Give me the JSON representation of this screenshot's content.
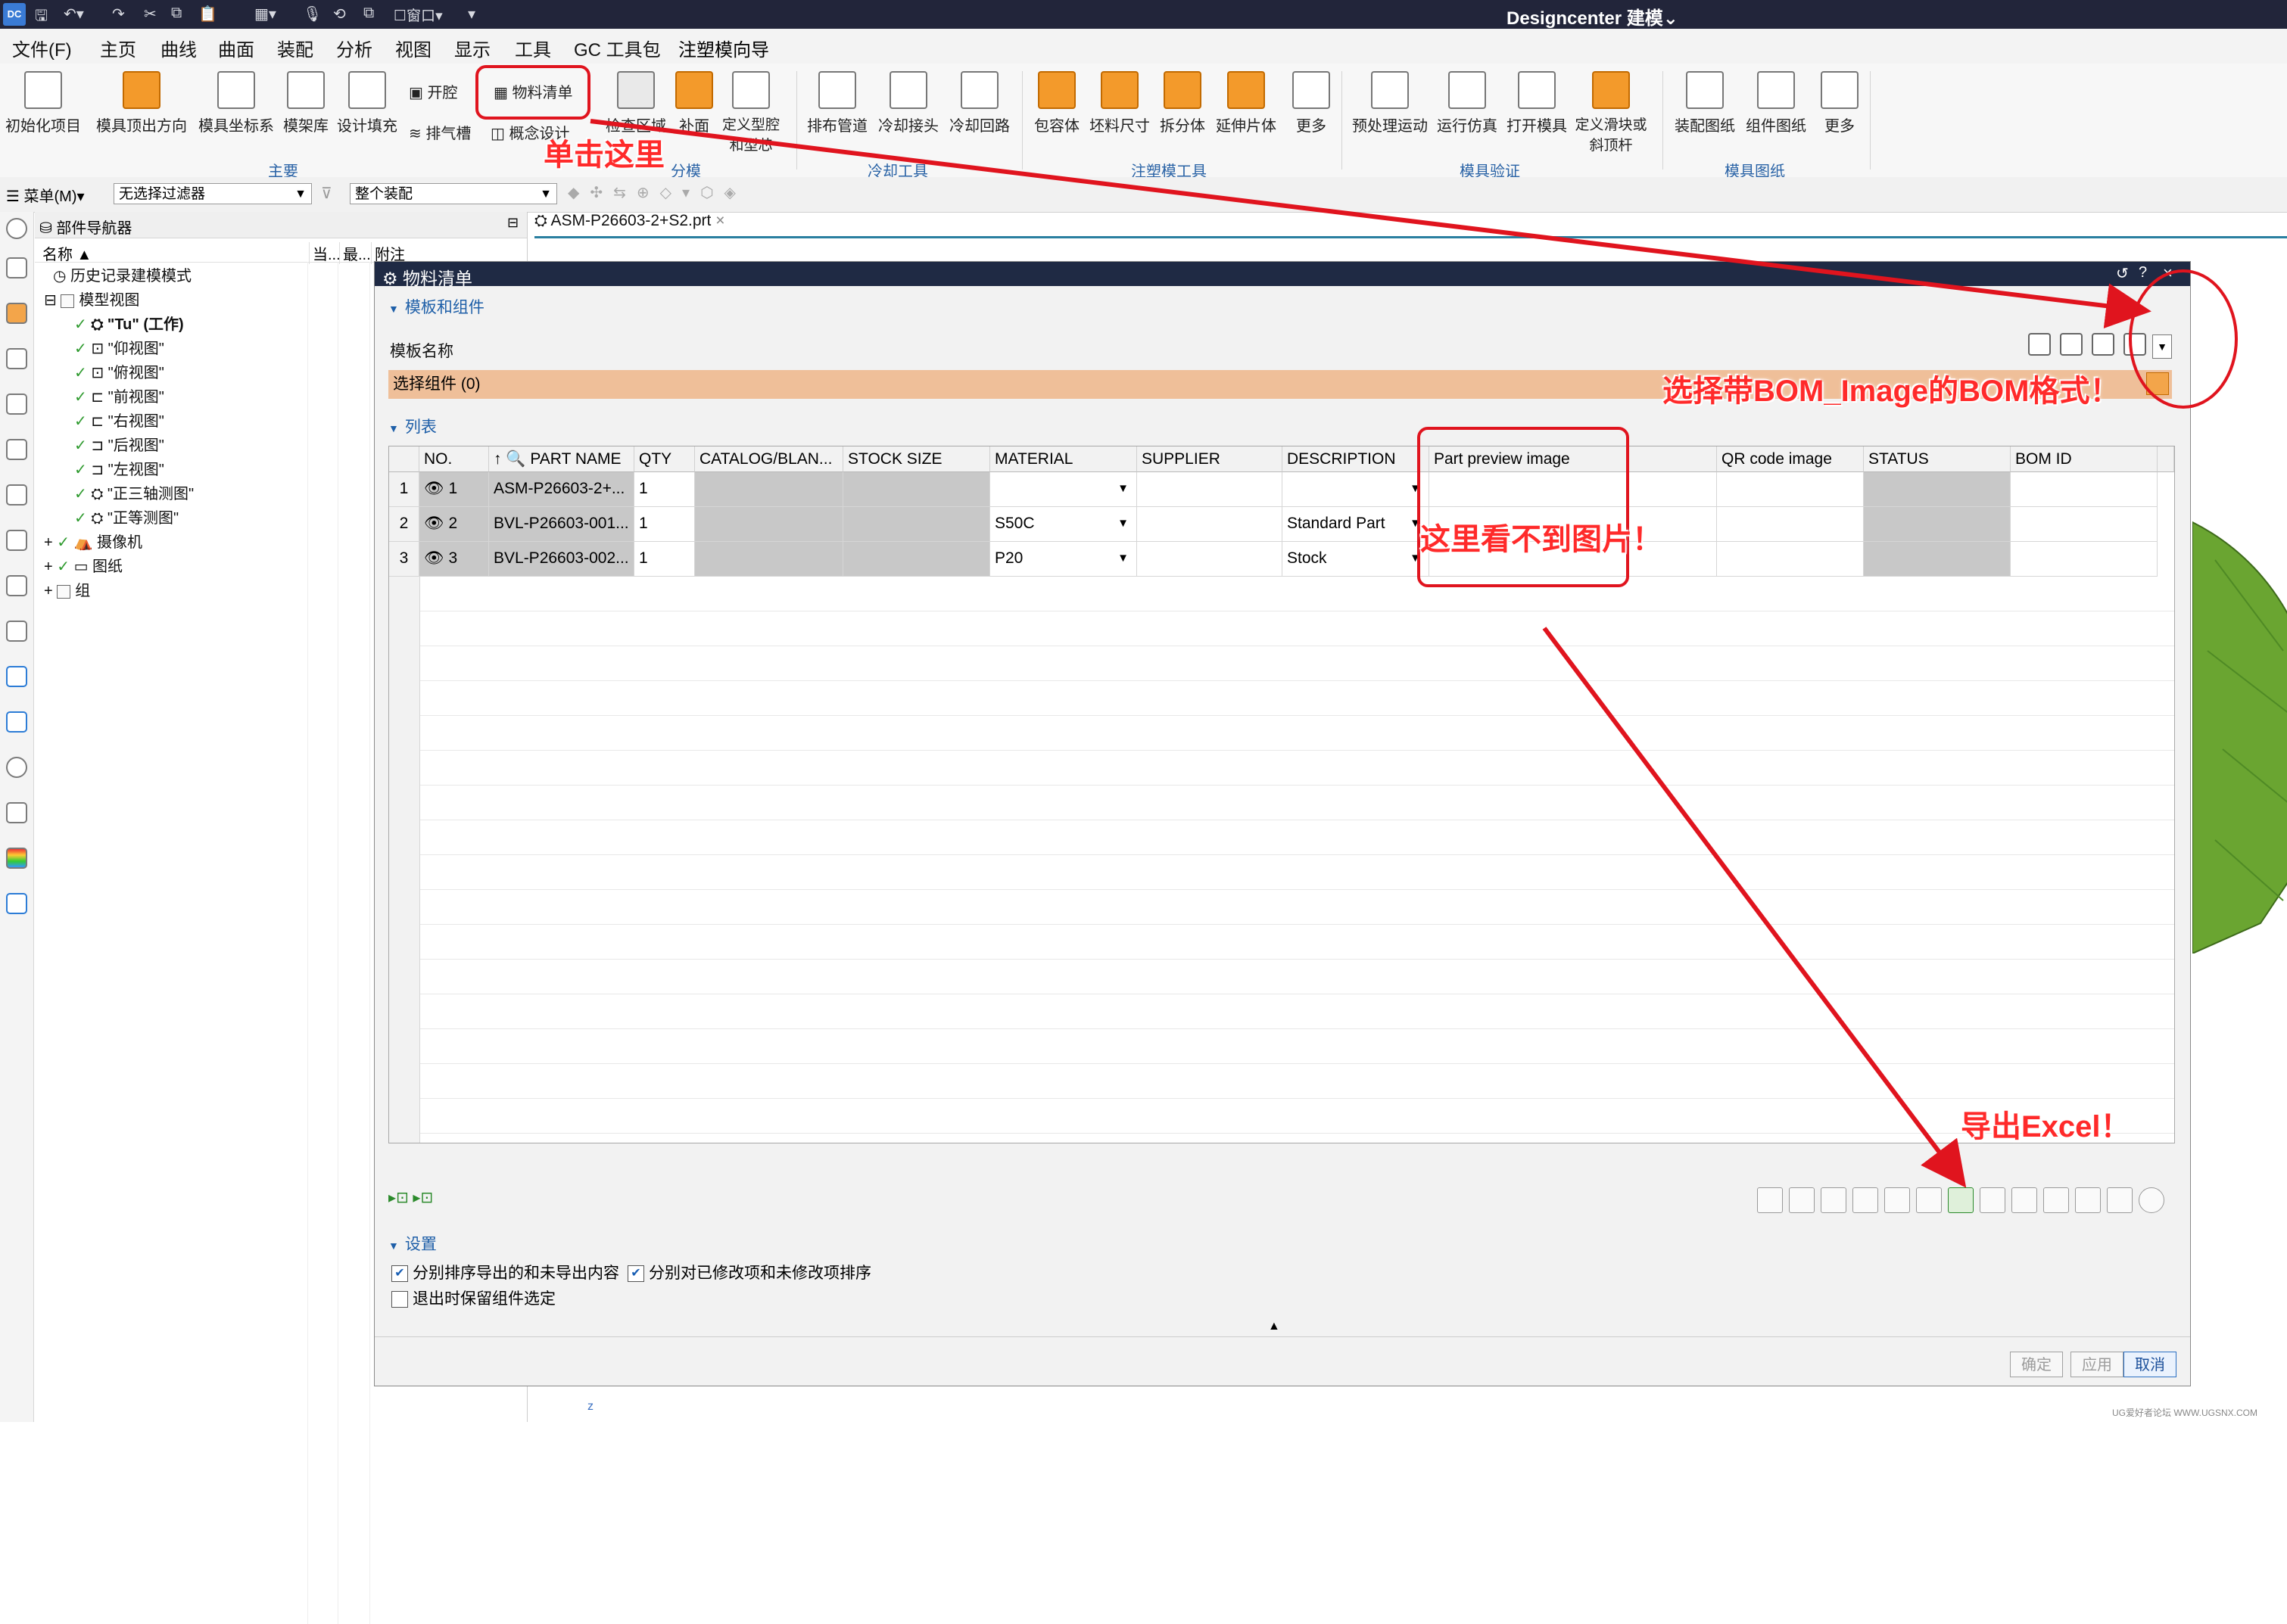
{
  "app": {
    "logo": "DC",
    "title": "Designcenter 建模",
    "window_menu": "窗口"
  },
  "menu": [
    "文件(F)",
    "主页",
    "曲线",
    "曲面",
    "装配",
    "分析",
    "视图",
    "显示",
    "工具",
    "GC 工具包",
    "注塑模向导"
  ],
  "ribbon": {
    "buttons": [
      "初始化项目",
      "模具顶出方向",
      "模具坐标系",
      "模架库",
      "设计填充",
      "开腔",
      "物料清单",
      "排气槽",
      "概念设计",
      "检查区域",
      "补面",
      "定义型腔和型芯",
      "排布管道",
      "冷却接头",
      "冷却回路",
      "包容体",
      "坯料尺寸",
      "拆分体",
      "延伸片体",
      "更多",
      "预处理运动",
      "运行仿真",
      "打开模具",
      "定义滑块或斜顶杆",
      "装配图纸",
      "组件图纸",
      "更多"
    ],
    "groups": [
      "主要",
      "分模",
      "冷却工具",
      "注塑模工具",
      "模具验证",
      "模具图纸"
    ]
  },
  "filterbar": {
    "menu_label": "菜单(M)",
    "filter": "无选择过滤器",
    "scope": "整个装配"
  },
  "navigator": {
    "title": "部件导航器",
    "columns": [
      "名称",
      "当...",
      "最...",
      "附注"
    ],
    "rows": [
      "历史记录建模模式",
      "模型视图",
      "\"Tu\" (工作)",
      "\"仰视图\"",
      "\"俯视图\"",
      "\"前视图\"",
      "\"右视图\"",
      "\"后视图\"",
      "\"左视图\"",
      "\"正三轴测图\"",
      "\"正等测图\"",
      "摄像机",
      "图纸",
      "组"
    ]
  },
  "file_tab": "ASM-P26603-2+S2.prt",
  "dialog": {
    "title": "物料清单",
    "section_templates": "模板和组件",
    "template_label": "模板名称",
    "select_components": "选择组件 (0)",
    "section_list": "列表",
    "section_settings": "设置",
    "columns": [
      "NO.",
      "PART NAME",
      "QTY",
      "CATALOG/BLAN...",
      "STOCK SIZE",
      "MATERIAL",
      "SUPPLIER",
      "DESCRIPTION",
      "Part preview image",
      "QR code image",
      "STATUS",
      "BOM ID"
    ],
    "rows": [
      {
        "row": "1",
        "no": "1",
        "part": "ASM-P26603-2+...",
        "qty": "1",
        "material": "",
        "description": ""
      },
      {
        "row": "2",
        "no": "2",
        "part": "BVL-P26603-001...",
        "qty": "1",
        "material": "S50C",
        "description": "Standard Part"
      },
      {
        "row": "3",
        "no": "3",
        "part": "BVL-P26603-002...",
        "qty": "1",
        "material": "P20",
        "description": "Stock"
      }
    ],
    "settings": {
      "opt1": "分别排序导出的和未导出内容",
      "opt2": "分别对已修改项和未修改项排序",
      "opt3": "退出时保留组件选定"
    },
    "buttons": {
      "ok": "确定",
      "apply": "应用",
      "cancel": "取消"
    }
  },
  "annotations": {
    "click_here": "单击这里",
    "choose_format": "选择带BOM_Image的BOM格式！",
    "no_image": "这里看不到图片！",
    "export": "导出Excel！",
    "color": "#e0141e"
  },
  "watermark": "UG爱好者论坛 WWW.UGSNX.COM"
}
